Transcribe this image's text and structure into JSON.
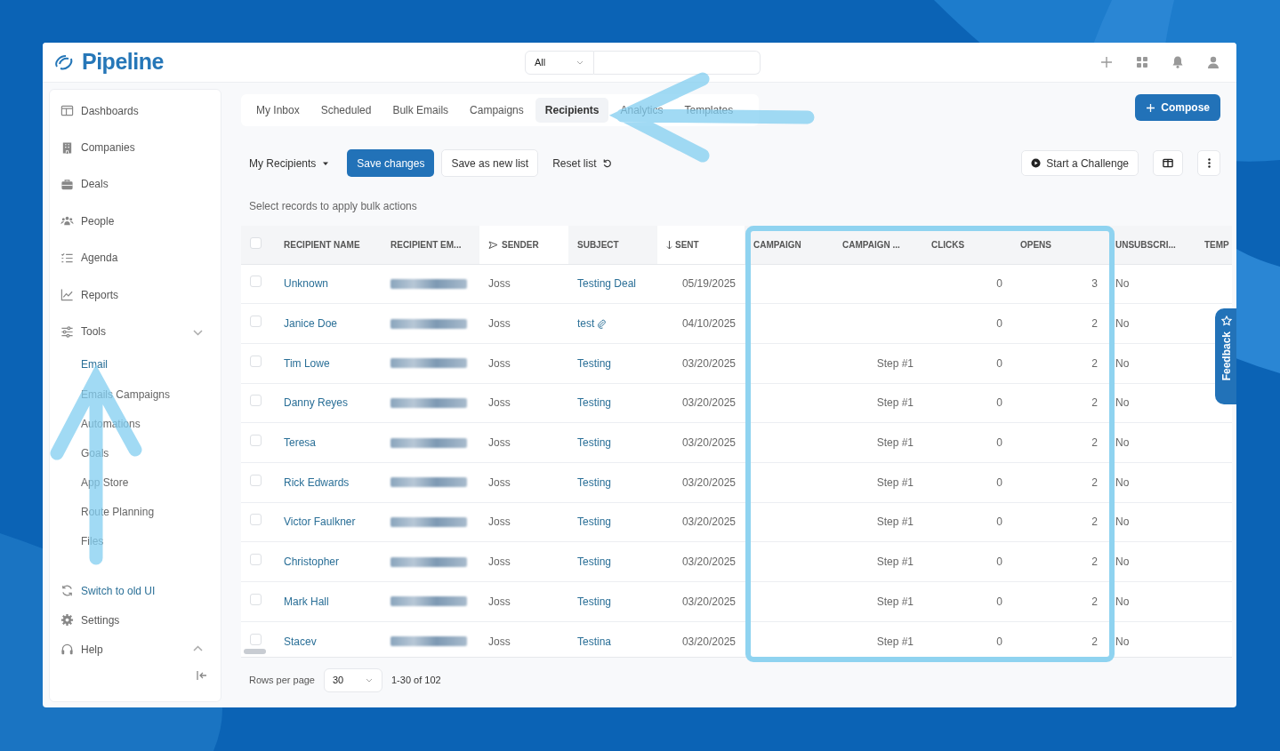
{
  "app": {
    "logo": "Pipeline"
  },
  "top_bar": {
    "scope": "All"
  },
  "sidebar": {
    "items": [
      {
        "label": "Dashboards"
      },
      {
        "label": "Companies"
      },
      {
        "label": "Deals"
      },
      {
        "label": "People"
      },
      {
        "label": "Agenda"
      },
      {
        "label": "Reports"
      },
      {
        "label": "Tools",
        "expanded": true,
        "children": [
          {
            "label": "Email",
            "selected": true
          },
          {
            "label": "Emails Campaigns",
            "selected": false
          },
          {
            "label": "Automations",
            "selected": false
          },
          {
            "label": "Goals",
            "selected": false
          },
          {
            "label": "App Store",
            "selected": false
          },
          {
            "label": "Route Planning",
            "selected": false
          },
          {
            "label": "Files",
            "selected": false
          }
        ]
      }
    ],
    "bottom_items": [
      {
        "label": "Switch to old UI",
        "kind": "link"
      },
      {
        "label": "Settings",
        "kind": "plain"
      },
      {
        "label": "Help",
        "kind": "plain",
        "expanded": false
      }
    ]
  },
  "tabs": [
    {
      "label": "My Inbox",
      "selected": false
    },
    {
      "label": "Scheduled",
      "selected": false
    },
    {
      "label": "Bulk Emails",
      "selected": false
    },
    {
      "label": "Campaigns",
      "selected": false
    },
    {
      "label": "Recipients",
      "selected": true
    },
    {
      "label": "Analytics",
      "selected": false
    },
    {
      "label": "Templates",
      "selected": false
    }
  ],
  "compose_button": "Compose",
  "toolbar": {
    "list_dropdown": "My Recipients",
    "save_button": "Save changes",
    "save_new_button": "Save as new list",
    "reset_button": "Reset list",
    "challenge_button": "Start a Challenge"
  },
  "hint": "Select records to apply bulk actions",
  "table": {
    "select_all_checked": false,
    "columns": [
      "RECIPIENT NAME",
      "RECIPIENT EM...",
      "SENDER",
      "SUBJECT",
      "SENT",
      "CAMPAIGN",
      "CAMPAIGN ...",
      "CLICKS",
      "OPENS",
      "UNSUBSCRI...",
      "TEMP"
    ],
    "rows": [
      {
        "checked": false,
        "name": "Unknown",
        "sender": "Joss",
        "subject": "Testing Deal",
        "attachment": false,
        "sent": "05/19/2025",
        "step": "",
        "clicks": "0",
        "opens": "3",
        "unsubscribed": "No"
      },
      {
        "checked": false,
        "name": "Janice Doe",
        "sender": "Joss",
        "subject": "test",
        "attachment": true,
        "sent": "04/10/2025",
        "step": "",
        "clicks": "0",
        "opens": "2",
        "unsubscribed": "No"
      },
      {
        "checked": false,
        "name": "Tim Lowe",
        "sender": "Joss",
        "subject": "Testing",
        "attachment": false,
        "sent": "03/20/2025",
        "step": "Step #1",
        "clicks": "0",
        "opens": "2",
        "unsubscribed": "No"
      },
      {
        "checked": false,
        "name": "Danny Reyes",
        "sender": "Joss",
        "subject": "Testing",
        "attachment": false,
        "sent": "03/20/2025",
        "step": "Step #1",
        "clicks": "0",
        "opens": "2",
        "unsubscribed": "No"
      },
      {
        "checked": false,
        "name": "Teresa",
        "sender": "Joss",
        "subject": "Testing",
        "attachment": false,
        "sent": "03/20/2025",
        "step": "Step #1",
        "clicks": "0",
        "opens": "2",
        "unsubscribed": "No"
      },
      {
        "checked": false,
        "name": "Rick Edwards",
        "sender": "Joss",
        "subject": "Testing",
        "attachment": false,
        "sent": "03/20/2025",
        "step": "Step #1",
        "clicks": "0",
        "opens": "2",
        "unsubscribed": "No"
      },
      {
        "checked": false,
        "name": "Victor Faulkner",
        "sender": "Joss",
        "subject": "Testing",
        "attachment": false,
        "sent": "03/20/2025",
        "step": "Step #1",
        "clicks": "0",
        "opens": "2",
        "unsubscribed": "No"
      },
      {
        "checked": false,
        "name": "Christopher",
        "sender": "Joss",
        "subject": "Testing",
        "attachment": false,
        "sent": "03/20/2025",
        "step": "Step #1",
        "clicks": "0",
        "opens": "2",
        "unsubscribed": "No"
      },
      {
        "checked": false,
        "name": "Mark Hall",
        "sender": "Joss",
        "subject": "Testing",
        "attachment": false,
        "sent": "03/20/2025",
        "step": "Step #1",
        "clicks": "0",
        "opens": "2",
        "unsubscribed": "No"
      },
      {
        "checked": false,
        "name": "Stacev",
        "sender": "Joss",
        "subject": "Testina",
        "attachment": false,
        "sent": "03/20/2025",
        "step": "Step #1",
        "clicks": "0",
        "opens": "2",
        "unsubscribed": "No"
      }
    ]
  },
  "pager": {
    "label": "Rows per page",
    "value": "30",
    "range": "1-30 of 102"
  },
  "feedback_tab": "Feedback"
}
